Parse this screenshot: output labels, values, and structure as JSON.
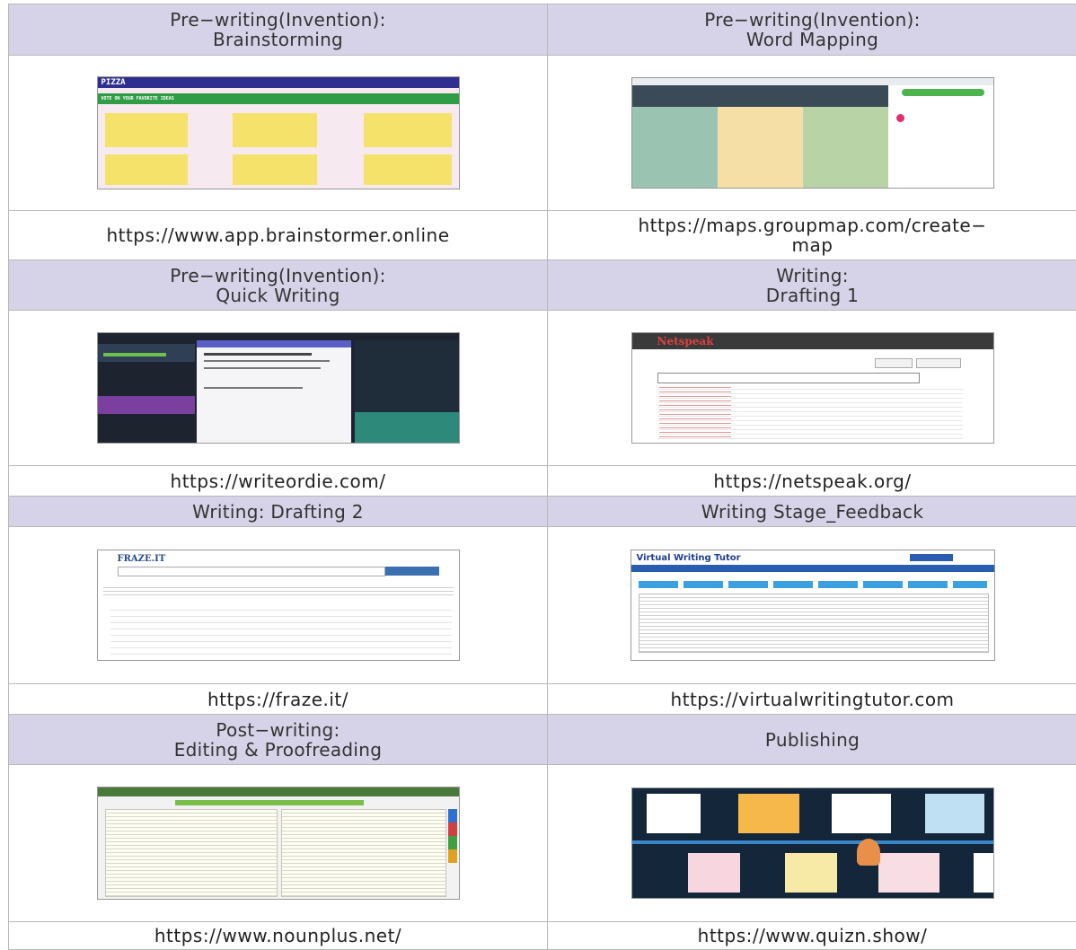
{
  "tools": [
    {
      "heading_lines": [
        "Pre−writing(Invention):",
        "Brainstorming"
      ],
      "url_lines": [
        "https://www.app.brainstormer.online"
      ],
      "shot": "brainstorm",
      "shot_text": {
        "title": "PIZZA",
        "banner": "VOTE ON YOUR FAVORITE IDEAS"
      }
    },
    {
      "heading_lines": [
        "Pre−writing(Invention):",
        "Word Mapping"
      ],
      "url_lines": [
        "https://maps.groupmap.com/create−",
        "map"
      ],
      "shot": "groupmap"
    },
    {
      "heading_lines": [
        "Pre−writing(Invention):",
        "Quick Writing"
      ],
      "url_lines": [
        "https://writeordie.com/"
      ],
      "shot": "writeordie"
    },
    {
      "heading_lines": [
        "Writing:",
        "Drafting 1"
      ],
      "url_lines": [
        "https://netspeak.org/"
      ],
      "shot": "netspeak",
      "shot_text": {
        "logo": "Netspeak"
      }
    },
    {
      "heading_lines": [
        "Writing: Drafting 2"
      ],
      "url_lines": [
        "https://fraze.it/"
      ],
      "shot": "fraze",
      "shot_text": {
        "logo": "FRAZE.IT"
      }
    },
    {
      "heading_lines": [
        "Writing Stage_Feedback"
      ],
      "url_lines": [
        "https://virtualwritingtutor.com"
      ],
      "shot": "vwt",
      "shot_text": {
        "logo": "Virtual Writing Tutor"
      }
    },
    {
      "heading_lines": [
        "Post−writing:",
        "Editing & Proofreading"
      ],
      "url_lines": [
        "https://www.nounplus.net/"
      ],
      "shot": "nounplus"
    },
    {
      "heading_lines": [
        "Publishing"
      ],
      "url_lines": [
        "https://www.quizn.show/"
      ],
      "shot": "quizn"
    }
  ],
  "colors": {
    "header_bg": "#d6d3e8",
    "border": "#b8b8b8"
  }
}
